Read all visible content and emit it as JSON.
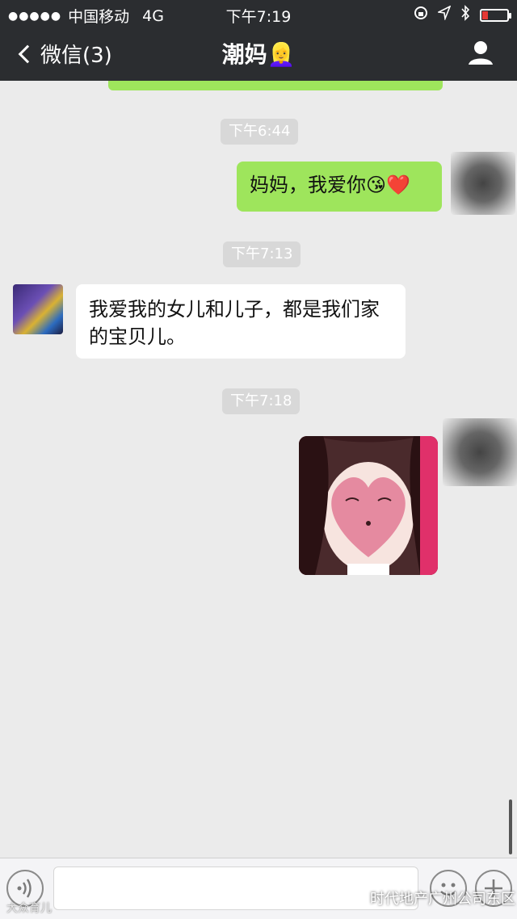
{
  "status_bar": {
    "signal": "●●●●●",
    "carrier": "中国移动",
    "network": "4G",
    "time": "下午7:19"
  },
  "nav": {
    "back_label": "微信(3)",
    "title": "潮妈👱‍♀️"
  },
  "messages": [
    {
      "type": "timestamp",
      "text": "下午6:44"
    },
    {
      "type": "text",
      "from": "me",
      "text": "妈妈，我爱你😘❤️"
    },
    {
      "type": "timestamp",
      "text": "下午7:13"
    },
    {
      "type": "text",
      "from": "them",
      "text": "我爱我的女儿和儿子，都是我们家的宝贝儿。"
    },
    {
      "type": "timestamp",
      "text": "下午7:18"
    },
    {
      "type": "sticker",
      "from": "me"
    }
  ],
  "msg": {
    "ts1": "下午6:44",
    "m1": "妈妈，我爱你😘❤️",
    "ts2": "下午7:13",
    "m2": "我爱我的女儿和儿子，都是我们家的宝贝儿。",
    "ts3": "下午7:18"
  },
  "icons": {
    "voice": "voice-icon",
    "emoji": "emoji-icon",
    "plus": "plus-icon",
    "profile": "profile-icon",
    "back": "chevron-left-icon"
  },
  "watermarks": {
    "left": "大众育儿",
    "right": "时代地产广州公司东区"
  },
  "colors": {
    "nav_bg": "#2b2d30",
    "my_bubble": "#9ee55c",
    "their_bubble": "#ffffff",
    "chat_bg": "#ebebeb"
  }
}
